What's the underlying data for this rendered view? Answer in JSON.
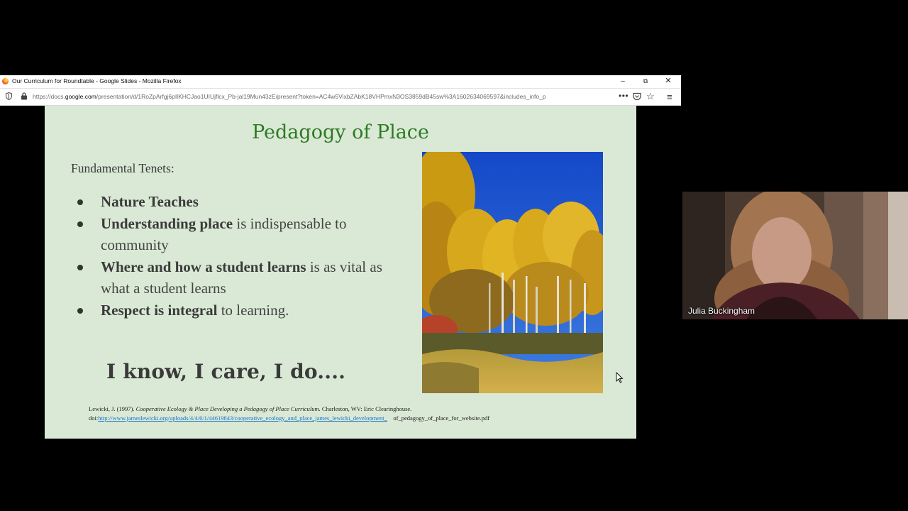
{
  "window": {
    "title": "Our Curriculum for Roundtable - Google Slides - Mozilla Firefox",
    "minimize": "–",
    "maximize": "⧉",
    "close": "✕"
  },
  "urlbar": {
    "url_prefix": "https://docs.",
    "url_domain": "google.com",
    "url_rest": "/presentation/d/1RoZpArfgj6pIlKHCJao1UIUjflcx_Pb-jal19Mun43zE/present?token=AC4w5VixbZAbK18VHPmxN3OS3859dB45sw%3A1602634069597&includes_info_p",
    "more": "•••",
    "star": "☆",
    "menu": "≡"
  },
  "slide": {
    "title": "Pedagogy of Place",
    "tenets_label": "Fundamental Tenets:",
    "bullets": [
      {
        "bold": "Nature Teaches",
        "rest": ""
      },
      {
        "bold": "Understanding place",
        "rest": " is indispensable to community"
      },
      {
        "bold": "Where and how a student learns",
        "rest": " is as vital as what a student learns"
      },
      {
        "bold": "Respect is integral",
        "rest": " to learning."
      }
    ],
    "motto": "I know, I care, I do....",
    "citation": {
      "line1_plain": "Lewicki, J. (1997). ",
      "line1_italic": "Cooperative Ecology & Place Developing a Pedagogy of Place Curriculum.",
      "line1_end": " Charleston, WV: Eric Clearinghouse.",
      "doi_label": "doi:",
      "link": "http://www.jameslewicki.org/uploads/4/4/6/1/44619843/cooperative_ecology_and_place_james_lewicki_development_",
      "link_end": "of_pedagogy_of_place_for_website.pdf"
    }
  },
  "video": {
    "participant_name": "Julia Buckingham"
  },
  "colors": {
    "slide_bg": "#dae9d5",
    "title_green": "#2e7a26",
    "link_blue": "#1a73c9"
  }
}
